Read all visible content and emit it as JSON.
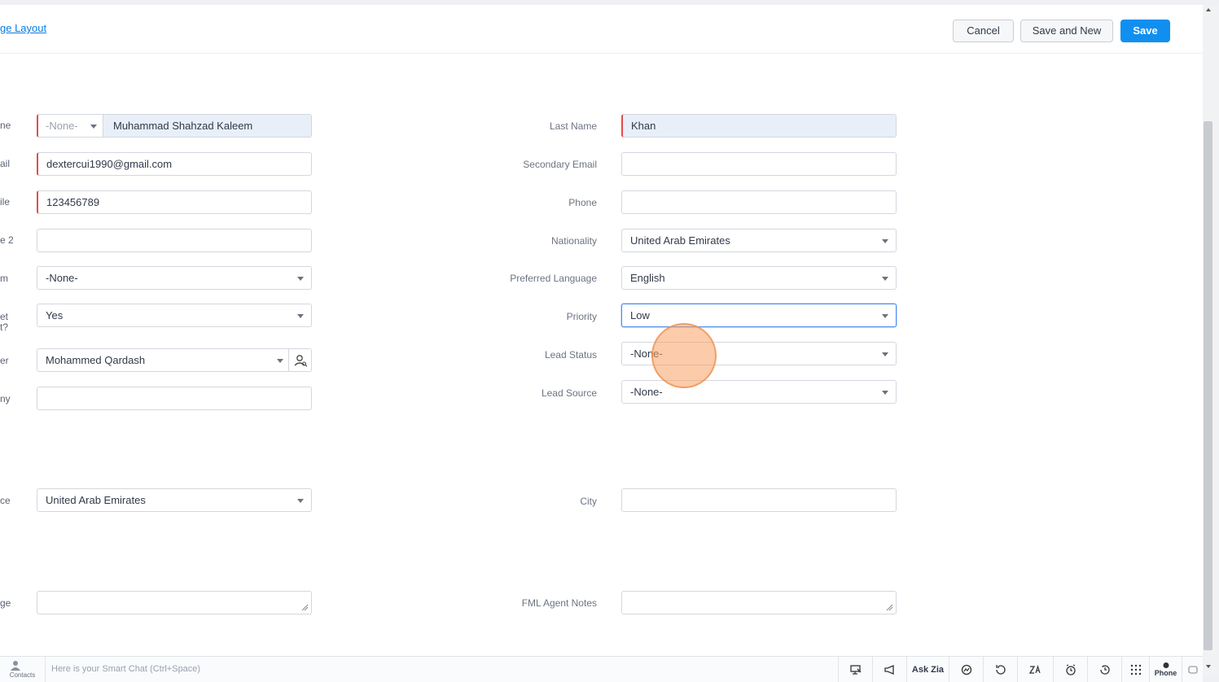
{
  "header": {
    "layout_link": "ge Layout",
    "cancel_label": "Cancel",
    "save_new_label": "Save and New",
    "save_label": "Save"
  },
  "left_labels": [
    "ne",
    "ail",
    "ile",
    "e 2",
    "m",
    "et\nt?",
    "er",
    "ny",
    "ce",
    "ge"
  ],
  "left_fields": {
    "salutation": "-None-",
    "first_name": "Muhammad Shahzad Kaleem",
    "email": "dextercui1990@gmail.com",
    "mobile": "123456789",
    "phone2": "",
    "from_select": "-None-",
    "yes_select": "Yes",
    "owner": "Mohammed Qardash",
    "company": "",
    "residence": "United Arab Emirates",
    "message": ""
  },
  "right_labels": {
    "last_name": "Last Name",
    "secondary_email": "Secondary Email",
    "phone": "Phone",
    "nationality": "Nationality",
    "preferred_language": "Preferred Language",
    "priority": "Priority",
    "lead_status": "Lead Status",
    "lead_source": "Lead Source",
    "city": "City",
    "fml_agent_notes": "FML Agent Notes"
  },
  "right_fields": {
    "last_name": "Khan",
    "secondary_email": "",
    "phone": "",
    "nationality": "United Arab Emirates",
    "preferred_language": "English",
    "priority": "Low",
    "lead_status": "-None-",
    "lead_source": "-None-",
    "city": "",
    "fml_agent_notes": ""
  },
  "bottombar": {
    "contacts_label": "Contacts",
    "smart_chat_placeholder": "Here is your Smart Chat (Ctrl+Space)",
    "ask_zia": "Ask Zia",
    "phone": "Phone"
  }
}
